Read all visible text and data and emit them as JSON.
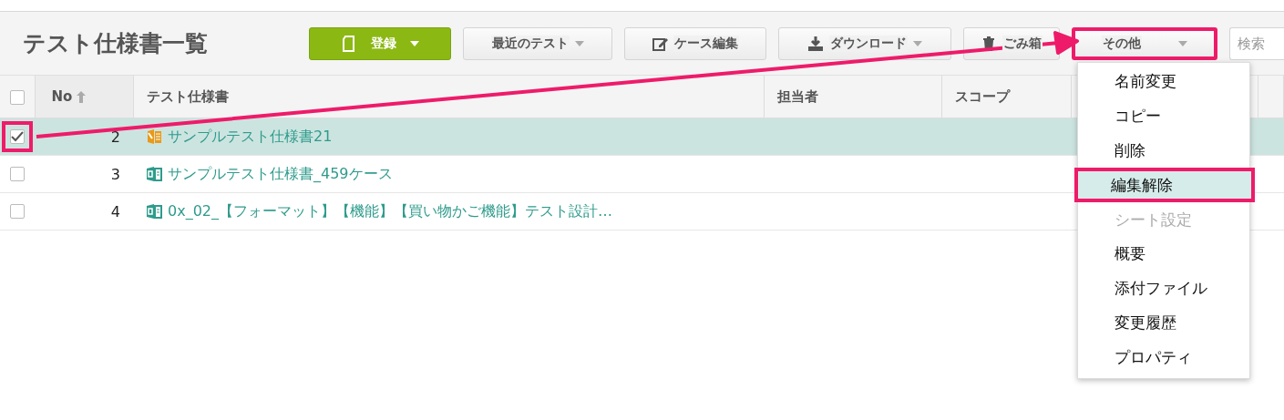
{
  "header": {
    "title": "テスト仕様書一覧"
  },
  "toolbar": [
    {
      "kind": "new",
      "label": "登録",
      "highlighted": false
    },
    {
      "kind": "recent",
      "label": "最近のテスト",
      "highlighted": false
    },
    {
      "kind": "edit",
      "label": "ケース編集",
      "highlighted": false
    },
    {
      "kind": "download",
      "label": "ダウンロード",
      "highlighted": false
    },
    {
      "kind": "trash",
      "label": "ごみ箱",
      "highlighted": false
    },
    {
      "kind": "more",
      "label": "その他",
      "highlighted": true
    }
  ],
  "search": {
    "placeholder": "検索"
  },
  "table": {
    "select_all": {
      "checked": false
    },
    "columns": [
      {
        "label": "No",
        "sorted": true
      },
      {
        "label": "テスト仕様書",
        "sorted": false
      },
      {
        "label": "担当者",
        "sorted": false
      },
      {
        "label": "スコープ",
        "sorted": false
      }
    ],
    "rows": [
      {
        "no": "2",
        "name": "サンプルテスト仕様書21",
        "editing": true,
        "checked": true,
        "selected": true,
        "highlighted": true
      },
      {
        "no": "3",
        "name": "サンプルテスト仕様書_459ケース",
        "editing": false,
        "checked": false,
        "selected": false,
        "highlighted": false
      },
      {
        "no": "4",
        "name": "0x_02_【フォーマット】【機能】【買い物かご機能】テスト設計…",
        "editing": false,
        "checked": false,
        "selected": false,
        "highlighted": false
      }
    ]
  },
  "menu": {
    "items": [
      {
        "label": "名前変更",
        "disabled": false,
        "highlighted": false
      },
      {
        "label": "コピー",
        "disabled": false,
        "highlighted": false
      },
      {
        "label": "削除",
        "disabled": false,
        "highlighted": false
      },
      {
        "label": "編集解除",
        "disabled": false,
        "highlighted": true
      },
      {
        "label": "シート設定",
        "disabled": true,
        "highlighted": false
      },
      {
        "label": "概要",
        "disabled": false,
        "highlighted": false
      },
      {
        "label": "添付ファイル",
        "disabled": false,
        "highlighted": false
      },
      {
        "label": "変更履歴",
        "disabled": false,
        "highlighted": false
      },
      {
        "label": "プロパティ",
        "disabled": false,
        "highlighted": false
      }
    ]
  },
  "annotation": {
    "arrow": true
  }
}
